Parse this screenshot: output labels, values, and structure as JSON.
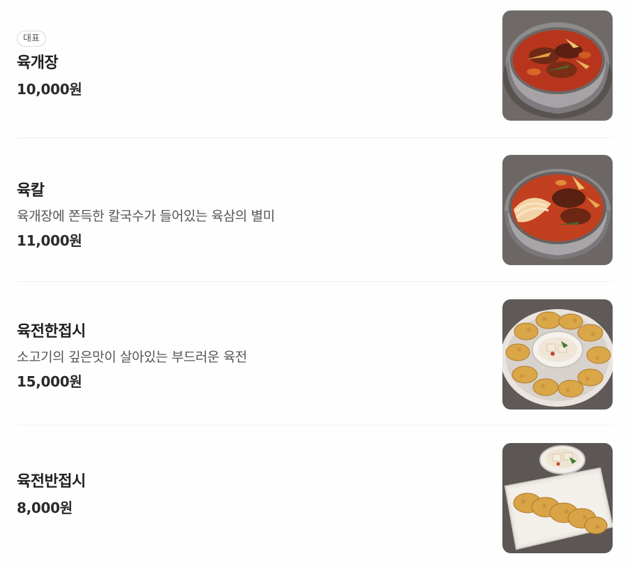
{
  "menu": {
    "items": [
      {
        "badge": "대표",
        "name": "육개장",
        "description": "",
        "price": "10,000원",
        "image_icon": "yukgaejang-bowl-photo"
      },
      {
        "badge": "",
        "name": "육칼",
        "description": "육개장에 쫀득한 칼국수가 들어있는 육삼의 별미",
        "price": "11,000원",
        "image_icon": "yukkal-noodle-bowl-photo"
      },
      {
        "badge": "",
        "name": "육전한접시",
        "description": "소고기의 깊은맛이 살아있는 부드러운 육전",
        "price": "15,000원",
        "image_icon": "yukjeon-full-plate-photo"
      },
      {
        "badge": "",
        "name": "육전반접시",
        "description": "",
        "price": "8,000원",
        "image_icon": "yukjeon-half-plate-photo"
      }
    ]
  },
  "colors": {
    "background": "#fefefe",
    "text_primary": "#1e1e1e",
    "text_secondary": "#555555",
    "divider": "#f1f1f1"
  }
}
